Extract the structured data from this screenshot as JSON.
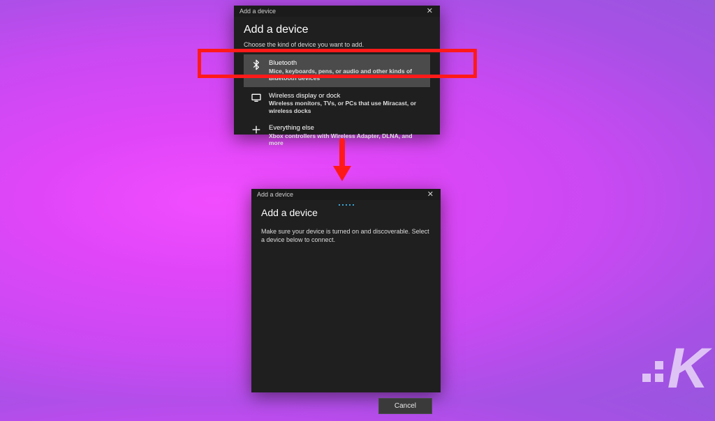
{
  "annotation": {
    "highlight_color": "#ff1a1a"
  },
  "dialog1": {
    "titlebar": "Add a device",
    "heading": "Add a device",
    "subheading": "Choose the kind of device you want to add.",
    "options": [
      {
        "icon": "bluetooth-icon",
        "title": "Bluetooth",
        "desc": "Mice, keyboards, pens, or audio and other kinds of Bluetooth devices"
      },
      {
        "icon": "wireless-display-icon",
        "title": "Wireless display or dock",
        "desc": "Wireless monitors, TVs, or PCs that use Miracast, or wireless docks"
      },
      {
        "icon": "plus-icon",
        "title": "Everything else",
        "desc": "Xbox controllers with Wireless Adapter, DLNA, and more"
      }
    ]
  },
  "dialog2": {
    "titlebar": "Add a device",
    "heading": "Add a device",
    "instructions": "Make sure your device is turned on and discoverable. Select a device below to connect.",
    "cancel": "Cancel"
  },
  "watermark": "K"
}
